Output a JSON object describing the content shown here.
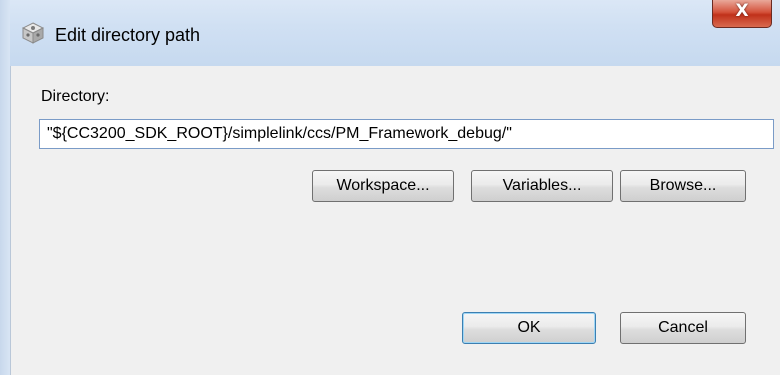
{
  "dialog": {
    "title": "Edit directory path",
    "close_glyph": "X"
  },
  "form": {
    "directory_label": "Directory:",
    "directory_value": "\"${CC3200_SDK_ROOT}/simplelink/ccs/PM_Framework_debug/\""
  },
  "buttons": {
    "workspace": "Workspace...",
    "variables": "Variables...",
    "browse": "Browse...",
    "ok": "OK",
    "cancel": "Cancel"
  },
  "icons": {
    "title_icon": "settings-cube-icon",
    "close_icon": "close-icon"
  },
  "colors": {
    "close_button": "#d4523b",
    "titlebar": "#d0e0f3",
    "default_button_border": "#3c7fb1"
  }
}
